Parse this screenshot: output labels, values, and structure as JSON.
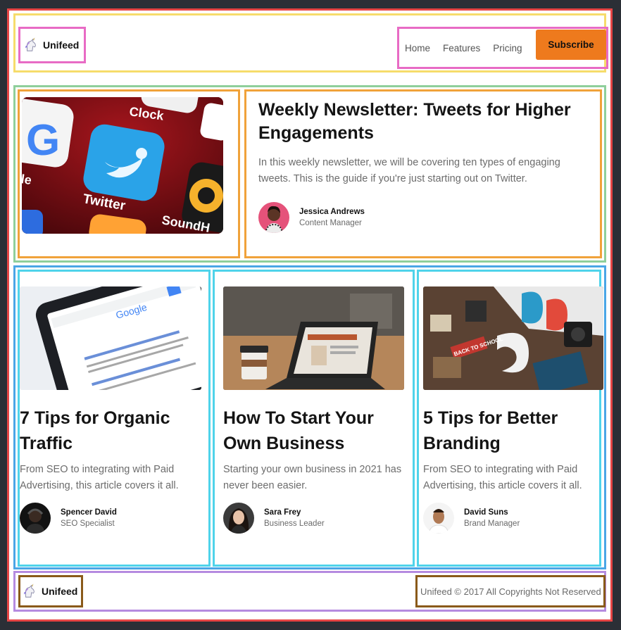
{
  "brand": {
    "name": "Unifeed",
    "logo_icon": "unicorn-icon"
  },
  "nav": {
    "links": [
      "Home",
      "Features",
      "Pricing"
    ],
    "subscribe_label": "Subscribe"
  },
  "featured": {
    "title": "Weekly Newsletter: Tweets for Higher Engagements",
    "description": "In this weekly newsletter, we will be covering ten types of engaging tweets. This is the guide if you're just starting out on Twitter.",
    "author": {
      "name": "Jessica Andrews",
      "role": "Content Manager"
    },
    "image_labels": [
      "Clock",
      "Twitter",
      "SoundH",
      "le"
    ]
  },
  "posts": [
    {
      "title": "7 Tips for Organic Traffic",
      "description": "From SEO to integrating with Paid Advertising, this article covers it all.",
      "author": {
        "name": "Spencer David",
        "role": "SEO Specialist"
      }
    },
    {
      "title": "How To Start Your Own Business",
      "description": "Starting your own business in 2021 has never been easier.",
      "author": {
        "name": "Sara Frey",
        "role": "Business Leader"
      }
    },
    {
      "title": "5 Tips for Better Branding",
      "description": "From SEO to integrating with Paid Advertising, this article covers it all.",
      "author": {
        "name": "David Suns",
        "role": "Brand Manager"
      }
    }
  ],
  "footer": {
    "copyright": "Unifeed © 2017 All Copyrights Not Reserved"
  },
  "colors": {
    "accent": "#ee7a1d",
    "text": "#141414",
    "muted": "#6c6c6c"
  }
}
